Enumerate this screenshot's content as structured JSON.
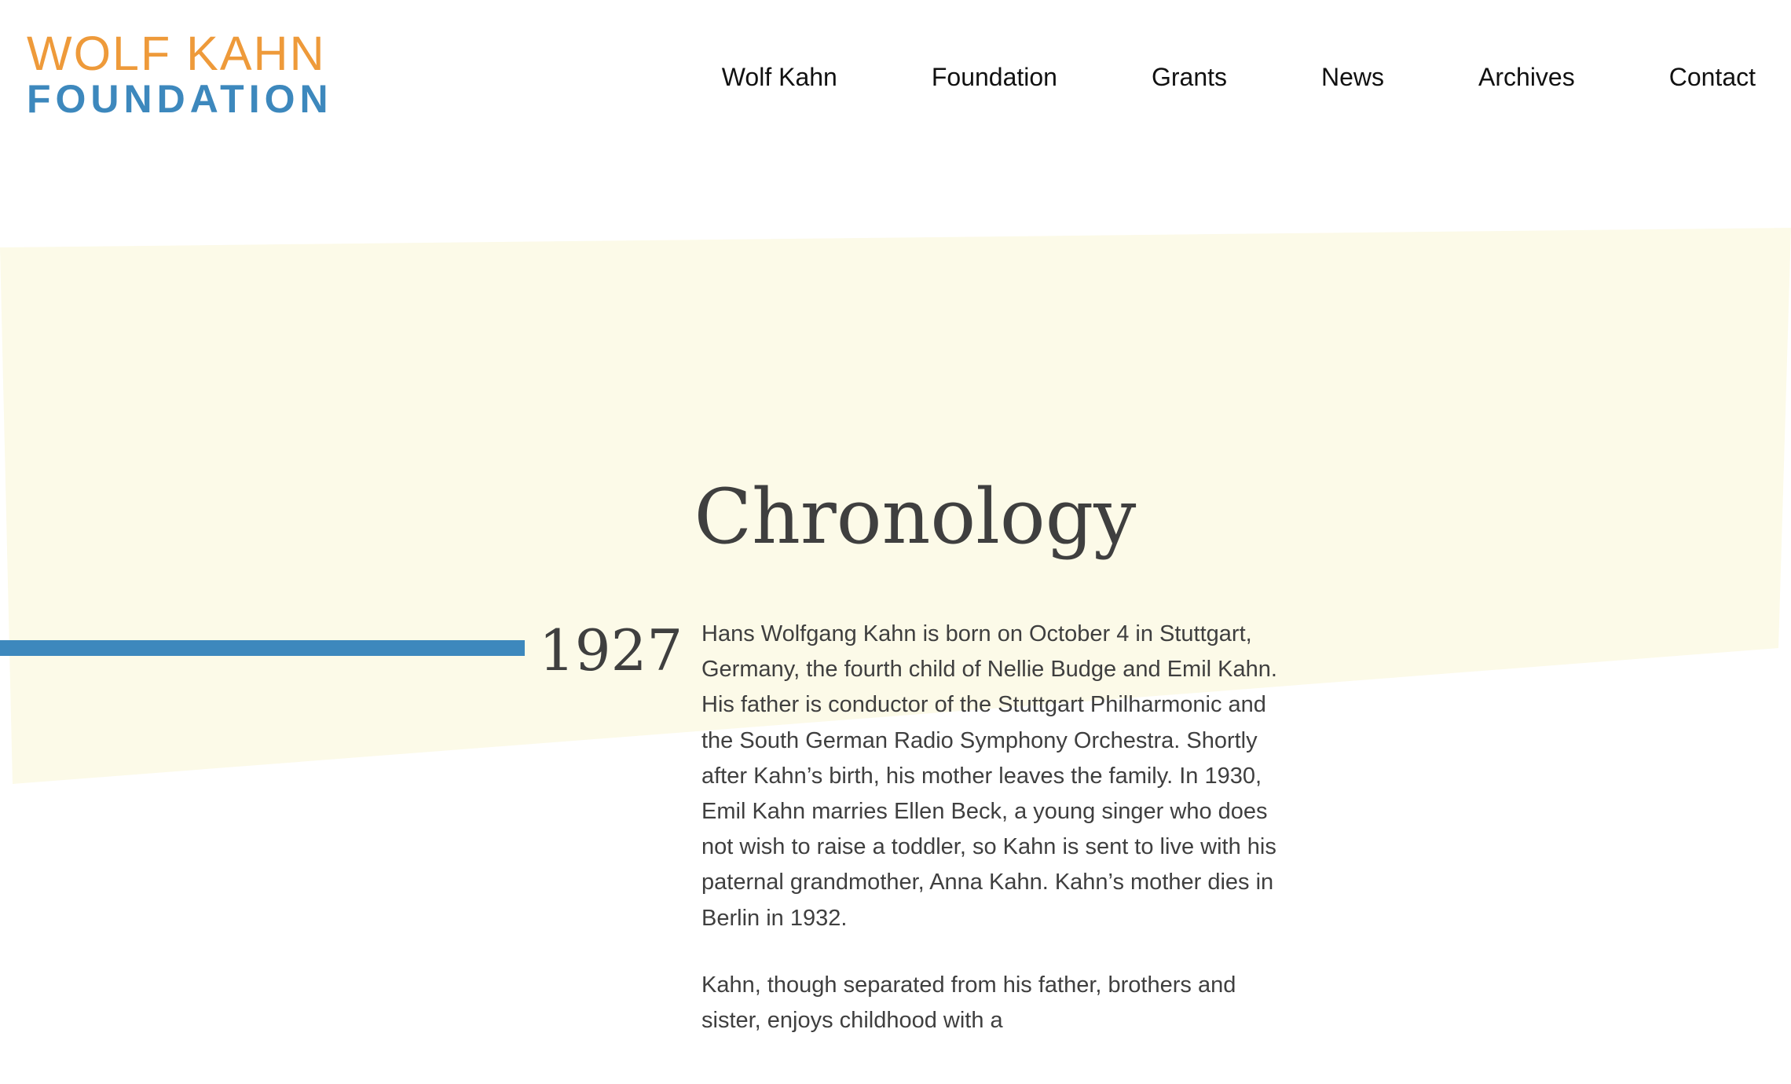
{
  "logo": {
    "line1": "WOLF KAHN",
    "line2": "FOUNDATION"
  },
  "nav": {
    "items": [
      "Wolf Kahn",
      "Foundation",
      "Grants",
      "News",
      "Archives",
      "Contact"
    ]
  },
  "page": {
    "title": "Chronology"
  },
  "timeline": {
    "entries": [
      {
        "year": "1927",
        "paragraphs": [
          "Hans Wolfgang Kahn is born on October 4 in Stuttgart, Germany, the fourth child of Nellie Budge and Emil Kahn. His father is conductor of the Stuttgart Philharmonic and the South German Radio Symphony Orchestra. Shortly after Kahn’s birth, his mother leaves the family. In 1930, Emil Kahn marries Ellen Beck, a young singer who does not wish to raise a toddler, so Kahn is sent to live with his paternal grandmother, Anna Kahn. Kahn’s mother dies in Berlin in 1932.",
          "Kahn, though separated from his father, brothers and sister, enjoys childhood with a"
        ]
      }
    ]
  },
  "colors": {
    "logo_orange": "#ee9a3a",
    "logo_blue": "#3d88bd",
    "band_yellow": "#fcfae8",
    "timeline_blue": "#3d88bd",
    "text": "#3f3f3f"
  }
}
